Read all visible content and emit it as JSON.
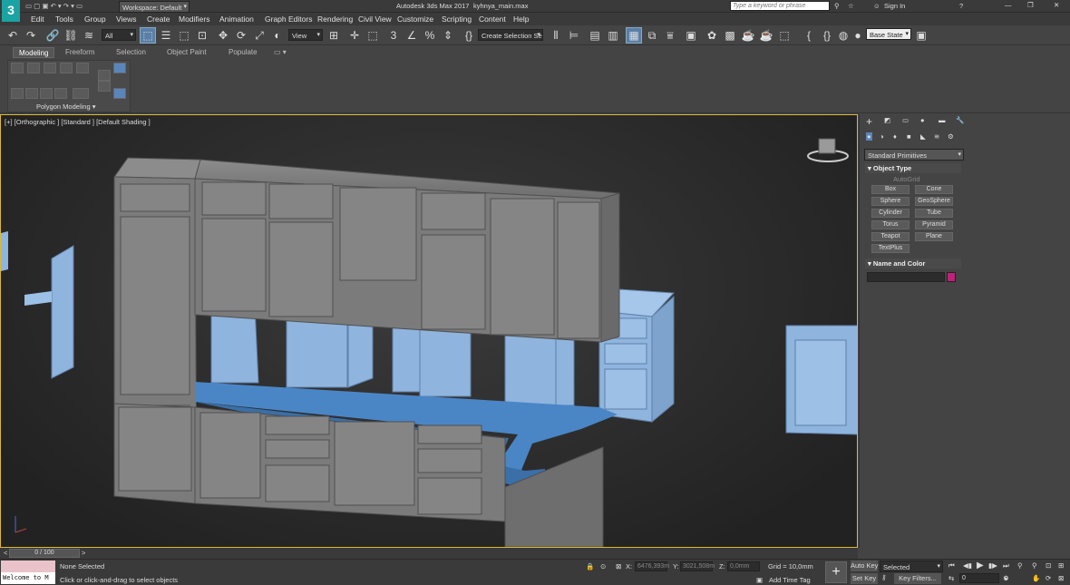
{
  "title_bar": {
    "workspace_label": "Workspace: Default",
    "app_title": "Autodesk 3ds Max 2017",
    "file_name": "kyhnya_main.max",
    "search_placeholder": "Type a keyword or phrase",
    "sign_in": "Sign In"
  },
  "menu": [
    "Edit",
    "Tools",
    "Group",
    "Views",
    "Create",
    "Modifiers",
    "Animation",
    "Graph Editors",
    "Rendering",
    "Civil View",
    "Customize",
    "Scripting",
    "Content",
    "Help"
  ],
  "toolbar": {
    "selection_filter": "All",
    "view_dropdown": "View",
    "create_selection_set": "Create Selection Se",
    "base_state": "Base State"
  },
  "ribbon": {
    "tabs": [
      "Modeling",
      "Freeform",
      "Selection",
      "Object Paint",
      "Populate"
    ],
    "panel_label": "Polygon Modeling"
  },
  "viewport": {
    "label": "[+] [Orthographic ] [Standard ] [Default Shading ]"
  },
  "command_panel": {
    "category": "Standard Primitives",
    "object_type_title": "Object Type",
    "autogrid": "AutoGrid",
    "buttons": [
      "Box",
      "Cone",
      "Sphere",
      "GeoSphere",
      "Cylinder",
      "Tube",
      "Torus",
      "Pyramid",
      "Teapot",
      "Plane",
      "TextPlus"
    ],
    "name_color_title": "Name and Color",
    "object_color": "#c0207a"
  },
  "timeline": {
    "frame": "0 / 100"
  },
  "status": {
    "maxscript": "Welcome to M",
    "selection": "None Selected",
    "prompt": "Click or click-and-drag to select objects",
    "x": "6476,393m",
    "y": "3021,508m",
    "z": "0,0mm",
    "grid": "Grid = 10,0mm",
    "add_time_tag": "Add Time Tag",
    "auto_key": "Auto Key",
    "selected": "Selected",
    "set_key": "Set Key",
    "key_filters": "Key Filters...",
    "frame_value": "0"
  },
  "colors": {
    "cabinet_gray": "#7b7b7b",
    "cabinet_blue": "#8fb4de",
    "countertop": "#4a86c6",
    "viewport_border": "#d8b838"
  }
}
